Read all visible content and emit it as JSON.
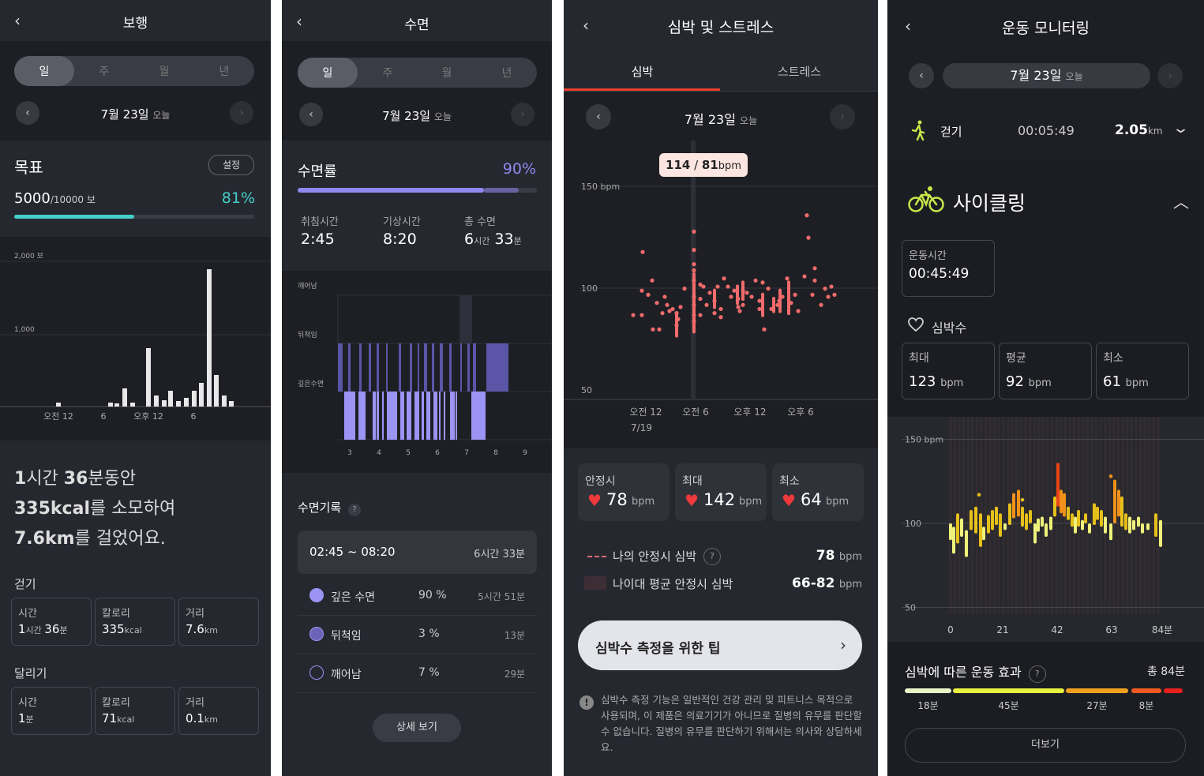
{
  "walk": {
    "title": "보행",
    "tabs": [
      "일",
      "주",
      "월",
      "년"
    ],
    "date": "7월 23일",
    "date_suffix": "오늘",
    "goal_label": "목표",
    "setting_button": "설정",
    "steps": "5000",
    "steps_goal": "/10000 보",
    "percent": "81%",
    "progress": 0.5,
    "chart": {
      "y_top_label": "2,000 보",
      "y_mid_label": "1,000",
      "x_labels": [
        "오전 12",
        "6",
        "오후 12",
        "6"
      ]
    },
    "summary": {
      "l1_bold1": "1",
      "l1_t1": "시간 ",
      "l1_bold2": "36",
      "l1_t2": "분동안",
      "l2_bold": "335kcal",
      "l2_t": "를 소모하여",
      "l3_bold": "7.6km",
      "l3_t": "를 걸었어요."
    },
    "walking_label": "걷기",
    "walking_stats": [
      {
        "label": "시간",
        "value": "1",
        "unit": "시간 ",
        "value2": "36",
        "unit2": "분"
      },
      {
        "label": "칼로리",
        "value": "335",
        "unit": "kcal",
        "value2": "",
        "unit2": ""
      },
      {
        "label": "거리",
        "value": "7.6",
        "unit": "km",
        "value2": "",
        "unit2": ""
      }
    ],
    "running_label": "달리기",
    "running_stats": [
      {
        "label": "시간",
        "value": "1",
        "unit": "분",
        "value2": "",
        "unit2": ""
      },
      {
        "label": "칼로리",
        "value": "71",
        "unit": "kcal",
        "value2": "",
        "unit2": ""
      },
      {
        "label": "거리",
        "value": "0.1",
        "unit": "km",
        "value2": "",
        "unit2": ""
      }
    ]
  },
  "sleep": {
    "title": "수면",
    "tabs": [
      "일",
      "주",
      "월",
      "년"
    ],
    "date": "7월 23일",
    "date_suffix": "오늘",
    "rate_label": "수면률",
    "rate_value": "90%",
    "rate_fraction": 0.9,
    "bedtime_label": "취침시간",
    "bedtime": "2:45",
    "wake_label": "기상시간",
    "wake": "8:20",
    "total_label": "총 수면",
    "total_h": "6",
    "total_h_unit": "시간",
    "total_m": "33",
    "total_m_unit": "분",
    "stage_labels": [
      "깨어남",
      "뒤척임",
      "깊은수면"
    ],
    "x_labels": [
      "3",
      "4",
      "5",
      "6",
      "7",
      "8",
      "9"
    ],
    "record_label": "수면기록",
    "help_icon": "?",
    "range": "02:45 ~ 08:20",
    "range_duration": "6시간 33분",
    "stages": [
      {
        "name": "깊은 수면",
        "percent": "90 %",
        "duration": "5시간 51분",
        "color": "#9b94f5"
      },
      {
        "name": "뒤척임",
        "percent": "3 %",
        "duration": "13분",
        "color": "#6a63b8"
      },
      {
        "name": "깨어남",
        "percent": "7 %",
        "duration": "29분",
        "color": "#262830"
      }
    ],
    "detail_button": "상세 보기"
  },
  "heart": {
    "title": "심박 및 스트레스",
    "tabs": [
      "심박",
      "스트레스"
    ],
    "date": "7월 23일",
    "date_suffix": "오늘",
    "tooltip_a": "114",
    "tooltip_sep": " / ",
    "tooltip_b": "81",
    "tooltip_unit": "bpm",
    "y_labels": [
      "150 bpm",
      "100",
      "50"
    ],
    "x_labels": [
      "오전 12",
      "오전 6",
      "오후 12",
      "오후 6"
    ],
    "x_sub": "7/19",
    "cards": [
      {
        "label": "안정시",
        "value": "78",
        "unit": "bpm"
      },
      {
        "label": "최대",
        "value": "142",
        "unit": "bpm"
      },
      {
        "label": "최소",
        "value": "64",
        "unit": "bpm"
      }
    ],
    "legend_rest": "나의 안정시 심박",
    "legend_rest_value": "78",
    "legend_age": "나이대 평균 안정시 심박",
    "legend_age_value": "66-82",
    "unit": "bpm",
    "info_icon": "?",
    "tip_button": "심박수 측정을 위한 팁",
    "disclaimer": "심박수 측정 기능은 일반적인 건강 관리 및 피트니스 목적으로 사용되며, 이 제품은 의료기기가 아니므로 질병의 유무를 판단할 수 없습니다. 질병의 유무를 판단하기 위해서는 의사와 상담하세요."
  },
  "exercise": {
    "title": "운동 모니터링",
    "date": "7월 23일",
    "date_suffix": "오늘",
    "walk_label": "걷기",
    "walk_time": "00:05:49",
    "walk_dist": "2.05",
    "walk_dist_unit": "km",
    "cycling_label": "사이클링",
    "duration_label": "운동시간",
    "duration": "00:45:49",
    "hr_label": "심박수",
    "hr_stats": [
      {
        "label": "최대",
        "value": "123",
        "unit": "bpm"
      },
      {
        "label": "평균",
        "value": "92",
        "unit": "bpm"
      },
      {
        "label": "최소",
        "value": "61",
        "unit": "bpm"
      }
    ],
    "y_labels": [
      "150 bpm",
      "100",
      "50"
    ],
    "x_labels": [
      "0",
      "21",
      "42",
      "63",
      "84분"
    ],
    "effect_label": "심박에 따른 운동 효과",
    "effect_total": "총 84분",
    "help_icon": "?",
    "zones": [
      {
        "minutes": "18분",
        "color": "#e8f5c8"
      },
      {
        "minutes": "45분",
        "color": "#e8f040"
      },
      {
        "minutes": "27분",
        "color": "#f0a020"
      },
      {
        "minutes": "8분",
        "color": "#f05a20"
      },
      {
        "minutes": "",
        "color": "#e82020"
      }
    ],
    "more_button": "더보기"
  }
}
